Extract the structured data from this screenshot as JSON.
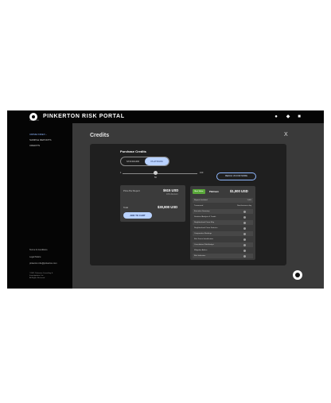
{
  "header": {
    "brand": "PINKERTON RISK PORTAL",
    "logo_text": "PINKERTON",
    "icons": [
      "user-icon",
      "bell-icon",
      "cart-icon"
    ]
  },
  "sidebar": {
    "items": [
      {
        "label": "CRIME INDEX ›",
        "active": true
      },
      {
        "label": "SAMPLE REPORTS",
        "active": false
      },
      {
        "label": "CREDITS",
        "active": false
      }
    ],
    "footer": {
      "terms": "Terms & Conditions",
      "legal": "Legal Notice",
      "email": "pinkerton.info@pinkerton.com",
      "company1": "©2021 Pinkerton Consulting &",
      "company2": "Investigations, Inc.",
      "company3": "All Rights Reserved"
    }
  },
  "modal": {
    "title": "Credits",
    "close_label": "X",
    "purchase_title": "Purchase Credits",
    "toggle": {
      "options": [
        "STANDARD",
        "PLATINUM"
      ],
      "selected": "PLATINUM"
    },
    "slider": {
      "min_label": "1",
      "max_label": "100",
      "value_label": "50",
      "value": 50
    },
    "reach_button": "REACH US FOR MORE",
    "summary": {
      "price_label": "Price Per Report",
      "price_value": "$615 USD",
      "discount": "10% discount",
      "total_label": "Total",
      "total_value": "$30,800 USD",
      "add_to_cart": "ADD TO CART"
    },
    "plan": {
      "badge": "Best Value",
      "name": "Platinum",
      "price": "$1,000 USD",
      "features": [
        {
          "label": "Reports Included",
          "value": "1,000"
        },
        {
          "label": "Turnaround",
          "value": "Next business day"
        },
        {
          "label": "Executive Summary",
          "check": true
        },
        {
          "label": "Statistical Analysis & Trends",
          "check": true
        },
        {
          "label": "Neighborhood Crime Map",
          "check": true
        },
        {
          "label": "Neighborhood Crime Statistics",
          "check": true
        },
        {
          "label": "Comparative Rankings",
          "check": true
        },
        {
          "label": "Risk Factor Identification",
          "check": true
        },
        {
          "label": "Consultation With Analyst",
          "check": true
        },
        {
          "label": "Mitigation Advice",
          "check": true
        },
        {
          "label": "Risk Indicators",
          "check": true
        }
      ]
    }
  }
}
